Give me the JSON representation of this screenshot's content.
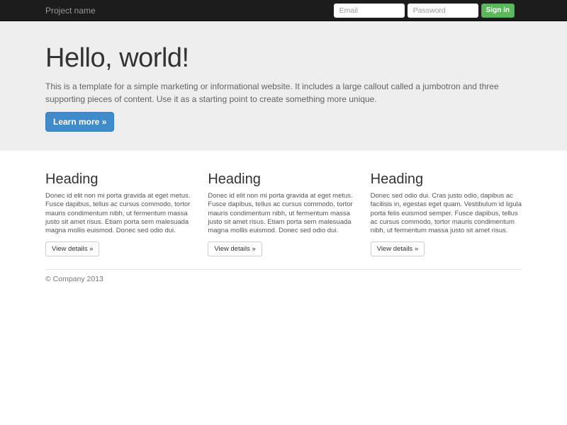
{
  "navbar": {
    "brand": "Project name",
    "form": {
      "email_placeholder": "Email",
      "password_placeholder": "Password",
      "signin_label": "Sign in"
    }
  },
  "jumbotron": {
    "title": "Hello, world!",
    "description": "This is a template for a simple marketing or informational website. It includes a large callout called a jumbotron and three supporting pieces of content. Use it as a starting point to create something more unique.",
    "cta_label": "Learn more »"
  },
  "columns": [
    {
      "heading": "Heading",
      "body": "Donec id elit non mi porta gravida at eget metus. Fusce dapibus, tellus ac cursus commodo, tortor mauris condimentum nibh, ut fermentum massa justo sit amet risus. Etiam porta sem malesuada magna mollis euismod. Donec sed odio dui.",
      "button_label": "View details »"
    },
    {
      "heading": "Heading",
      "body": "Donec id elit non mi porta gravida at eget metus. Fusce dapibus, tellus ac cursus commodo, tortor mauris condimentum nibh, ut fermentum massa justo sit amet risus. Etiam porta sem malesuada magna mollis euismod. Donec sed odio dui.",
      "button_label": "View details »"
    },
    {
      "heading": "Heading",
      "body": "Donec sed odio dui. Cras justo odio, dapibus ac facilisis in, egestas eget quam. Vestibulum id ligula porta felis euismod semper. Fusce dapibus, tellus ac cursus commodo, tortor mauris condimentum nibh, ut fermentum massa justo sit amet risus.",
      "button_label": "View details »"
    }
  ],
  "footer": {
    "copyright": "© Company 2013"
  },
  "colors": {
    "navbar_bg": "#1c1c1c",
    "jumbotron_bg": "#eeeeee",
    "primary": "#428bca",
    "primary_border": "#357ebd",
    "success": "#5cb85c",
    "success_border": "#4cae4c",
    "heading_text": "#333333",
    "muted_text": "#636363",
    "footer_text": "#777777"
  }
}
